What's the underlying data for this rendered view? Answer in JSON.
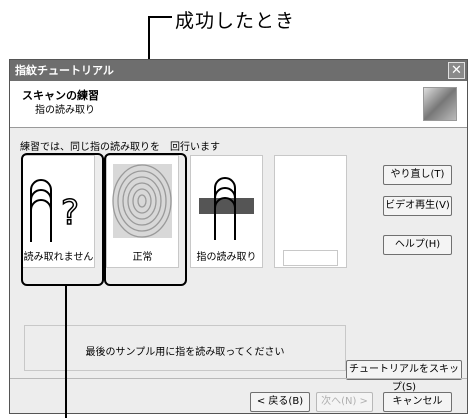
{
  "callout_top": "成功したとき",
  "window": {
    "title": "指紋チュートリアル",
    "close_glyph": "✕",
    "header_title": "スキャンの練習",
    "header_subtitle": "指の読み取り"
  },
  "instruction": "練習では、同じ指の読み取りを　回行います",
  "samples": [
    {
      "label": "読み取れません",
      "icon": "unknown-finger-icon"
    },
    {
      "label": "正常",
      "icon": "fingerprint-icon"
    },
    {
      "label": "指の読み取り",
      "icon": "finger-on-sensor-icon"
    },
    {
      "label": "",
      "icon": ""
    }
  ],
  "side_buttons": {
    "redo": "やり直し(T)",
    "video": "ビデオ再生(V)",
    "help": "ヘルプ(H)"
  },
  "message": "最後のサンプル用に指を読み取ってください",
  "skip_button": "チュートリアルをスキップ(S)",
  "nav_buttons": {
    "back": "< 戻る(B)",
    "next": "次へ(N) >",
    "cancel": "キャンセル"
  }
}
